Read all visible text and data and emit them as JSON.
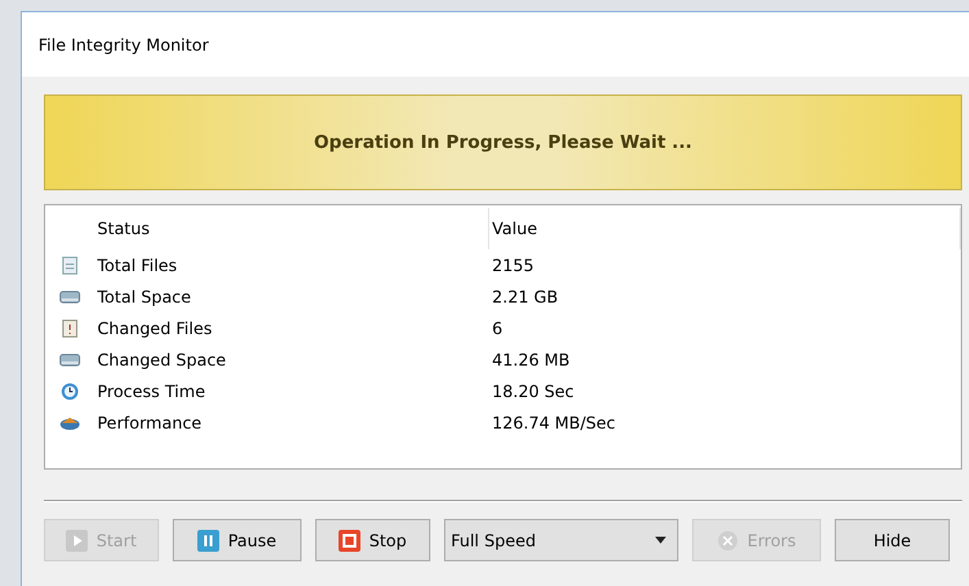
{
  "window": {
    "title": "File Integrity Monitor"
  },
  "banner": "Operation In Progress, Please Wait ...",
  "table": {
    "columns": [
      "Status",
      "Value"
    ],
    "rows": [
      {
        "kind": "file",
        "status": "Total Files",
        "value": "2155"
      },
      {
        "kind": "drive",
        "status": "Total Space",
        "value": "2.21 GB"
      },
      {
        "kind": "changed",
        "status": "Changed Files",
        "value": "6"
      },
      {
        "kind": "drive",
        "status": "Changed Space",
        "value": "41.26 MB"
      },
      {
        "kind": "clock",
        "status": "Process Time",
        "value": "18.20 Sec"
      },
      {
        "kind": "speed",
        "status": "Performance",
        "value": "126.74 MB/Sec"
      }
    ]
  },
  "buttons": [
    {
      "kind": "start",
      "label": "Start",
      "disabled": true
    },
    {
      "kind": "pause",
      "label": "Pause",
      "disabled": false
    },
    {
      "kind": "stop",
      "label": "Stop",
      "disabled": false
    }
  ],
  "speed": {
    "value": "Full Speed"
  },
  "buttons_right": [
    {
      "kind": "errors",
      "label": "Errors",
      "disabled": true
    },
    {
      "kind": "plain",
      "label": "Hide",
      "disabled": false
    }
  ]
}
